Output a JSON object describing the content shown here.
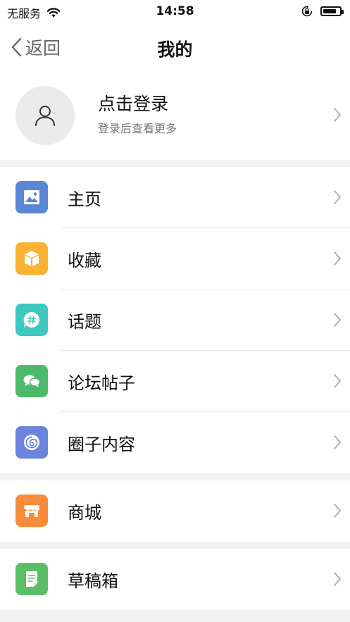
{
  "status_bar": {
    "carrier": "无服务",
    "time": "14:58",
    "battery_level": 0.8
  },
  "nav": {
    "back_label": "返回",
    "title": "我的"
  },
  "profile": {
    "title": "点击登录",
    "subtitle": "登录后查看更多"
  },
  "menu": {
    "group1": [
      {
        "label": "主页",
        "icon": "image-icon",
        "color": "#5b85d6"
      },
      {
        "label": "收藏",
        "icon": "box-icon",
        "color": "#f9b233"
      },
      {
        "label": "话题",
        "icon": "hashtag-icon",
        "color": "#3dc8c0"
      },
      {
        "label": "论坛帖子",
        "icon": "chat-bubbles-icon",
        "color": "#4cba6a"
      },
      {
        "label": "圈子内容",
        "icon": "circle-swirl-icon",
        "color": "#6b84de"
      }
    ],
    "group2": [
      {
        "label": "商城",
        "icon": "store-icon",
        "color": "#f98c3b"
      }
    ],
    "group3": [
      {
        "label": "草稿箱",
        "icon": "draft-icon",
        "color": "#5bbd66"
      }
    ]
  }
}
